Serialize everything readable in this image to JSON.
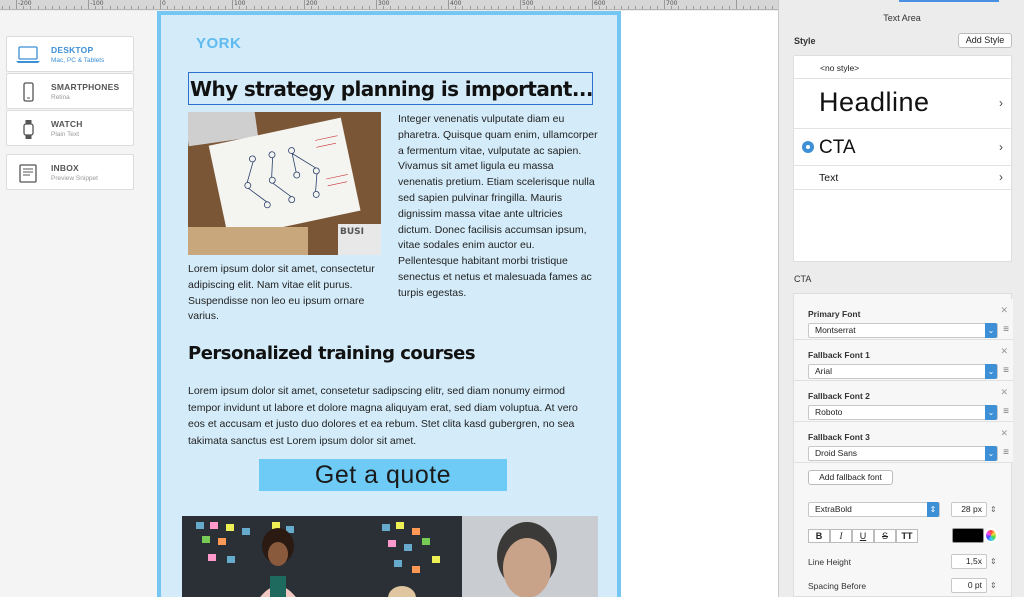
{
  "ruler": {
    "labels": [
      "-200",
      "-100",
      "0",
      "100",
      "200",
      "300",
      "400",
      "500",
      "600",
      "700"
    ]
  },
  "devices": [
    {
      "name": "DESKTOP",
      "sub": "Mac, PC & Tablets",
      "active": true,
      "icon": "laptop-icon"
    },
    {
      "name": "SMARTPHONES",
      "sub": "Retina",
      "active": false,
      "icon": "smartphone-icon"
    },
    {
      "name": "WATCH",
      "sub": "Plain Text",
      "active": false,
      "icon": "watch-icon"
    },
    {
      "name": "INBOX",
      "sub": "Preview Snippet",
      "active": false,
      "icon": "inbox-icon"
    }
  ],
  "email": {
    "logo": "YORK",
    "headline": "Why strategy planning is important...",
    "para1": "Integer venenatis vulputate diam eu pharetra. Quisque quam enim, ullamcorper a fermentum vitae, vulputate ac sapien. Vivamus sit amet ligula eu massa venenatis pretium. Etiam scelerisque nulla sed sapien pulvinar fringilla. Mauris dignissim massa vitae ante ultricies dictum. Donec facilisis accumsan ipsum, vitae sodales enim auctor eu. Pellentesque habitant morbi tristique senectus et netus et malesuada fames ac turpis egestas.",
    "para2": "Lorem ipsum dolor sit amet, consectetur adipiscing elit. Nam vitae elit purus. Suspendisse non leo eu ipsum ornare varius.",
    "heading2": "Personalized training courses",
    "para3": "Lorem ipsum dolor sit amet, consetetur sadipscing elitr, sed diam nonumy eirmod tempor invidunt ut labore et dolore magna aliquyam erat, sed diam voluptua. At vero eos et accusam et justo duo dolores et ea rebum. Stet clita kasd gubergren, no sea takimata sanctus est Lorem ipsum dolor sit amet.",
    "cta": "Get a quote",
    "photo_sign": "BUSI"
  },
  "inspector": {
    "title": "Text Area",
    "style_label": "Style",
    "add_style": "Add Style",
    "no_style": "<no style>",
    "styles": [
      {
        "label": "Headline",
        "selected": false
      },
      {
        "label": "CTA",
        "selected": true
      },
      {
        "label": "Text",
        "selected": false
      }
    ],
    "section_label": "CTA",
    "fonts": [
      {
        "label": "Primary Font",
        "value": "Montserrat"
      },
      {
        "label": "Fallback Font 1",
        "value": "Arial"
      },
      {
        "label": "Fallback Font 2",
        "value": "Roboto"
      },
      {
        "label": "Fallback Font 3",
        "value": "Droid Sans"
      }
    ],
    "add_fallback": "Add fallback font",
    "weight": "ExtraBold",
    "size": "28 px",
    "format": {
      "bold": "B",
      "italic": "I",
      "underline": "U",
      "strike": "S",
      "caps": "TT"
    },
    "text_color": "#000000",
    "line_height_label": "Line Height",
    "line_height": "1,5x",
    "spacing_before_label": "Spacing Before",
    "spacing_before": "0 pt"
  },
  "colors": {
    "accent": "#3d8fd6",
    "email_bg": "#d4ecfa",
    "email_border": "#75c6f2",
    "cta_bg": "#6ecbf5",
    "logo": "#5fbbef"
  }
}
